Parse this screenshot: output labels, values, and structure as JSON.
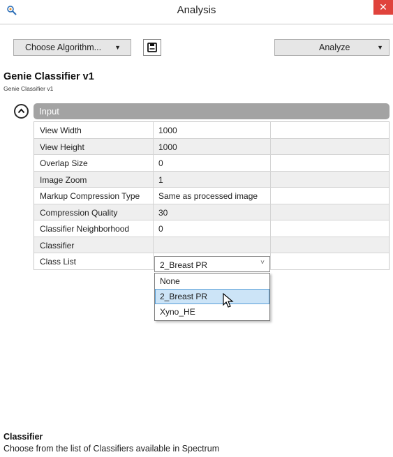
{
  "window": {
    "title": "Analysis",
    "close_glyph": "✕"
  },
  "toolbar": {
    "choose_algorithm_label": "Choose Algorithm...",
    "analyze_label": "Analyze",
    "dropdown_glyph": "▼"
  },
  "algorithm": {
    "name": "Genie Classifier v1",
    "subtitle": "Genie Classifier v1"
  },
  "section": {
    "label": "Input"
  },
  "properties": {
    "rows": [
      {
        "name": "View Width",
        "value": "1000"
      },
      {
        "name": "View Height",
        "value": "1000"
      },
      {
        "name": "Overlap Size",
        "value": "0"
      },
      {
        "name": "Image Zoom",
        "value": "1"
      },
      {
        "name": "Markup Compression Type",
        "value": "Same as processed image"
      },
      {
        "name": "Compression Quality",
        "value": "30"
      },
      {
        "name": "Classifier Neighborhood",
        "value": "0"
      },
      {
        "name": "Classifier",
        "value": ""
      },
      {
        "name": "Class List",
        "value": ""
      }
    ]
  },
  "classifier_select": {
    "selected": "2_Breast PR",
    "chevron": "˅",
    "options": [
      "None",
      "2_Breast PR",
      "Xyno_HE"
    ],
    "highlighted_option": "2_Breast PR"
  },
  "description": {
    "title": "Classifier",
    "text": "Choose from the list of Classifiers available in Spectrum"
  },
  "colors": {
    "close_button": "#e0433c",
    "section_header": "#a3a3a3",
    "selected_option": "#cce4f7"
  }
}
